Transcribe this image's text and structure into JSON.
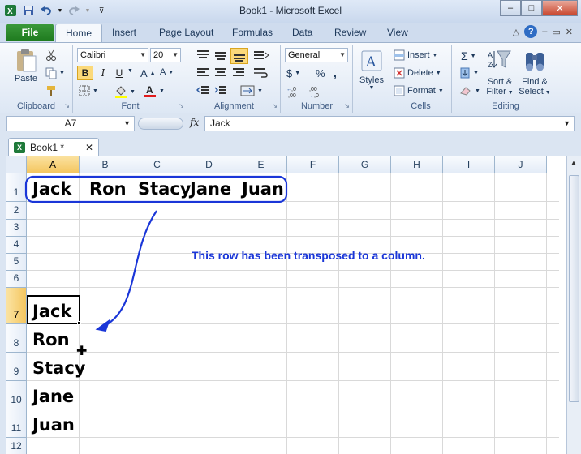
{
  "window": {
    "title": "Book1 - Microsoft Excel",
    "controls": {
      "minimize": "–",
      "maximize": "□",
      "close": "✕"
    }
  },
  "ribbon_tabs": {
    "file": "File",
    "tabs": [
      "Home",
      "Insert",
      "Page Layout",
      "Formulas",
      "Data",
      "Review",
      "View"
    ],
    "active": "Home"
  },
  "ribbon": {
    "clipboard": {
      "label": "Clipboard",
      "paste": "Paste"
    },
    "font": {
      "label": "Font",
      "name": "Calibri",
      "size": "20",
      "bold": "B",
      "italic": "I",
      "underline": "U"
    },
    "alignment": {
      "label": "Alignment"
    },
    "number": {
      "label": "Number",
      "format": "General",
      "currency": "$",
      "percent": "%",
      "comma": ","
    },
    "styles": {
      "label": "Styles"
    },
    "cells": {
      "label": "Cells",
      "insert": "Insert",
      "delete": "Delete",
      "format": "Format"
    },
    "editing": {
      "label": "Editing",
      "sort_line1": "Sort &",
      "sort_line2": "Filter",
      "find_line1": "Find &",
      "find_line2": "Select"
    }
  },
  "formula_bar": {
    "name_box": "A7",
    "fx": "fx",
    "value": "Jack"
  },
  "workbook_tab": {
    "title": "Book1 *",
    "close": "✕",
    "icon": "X"
  },
  "sheet": {
    "columns": [
      "A",
      "B",
      "C",
      "D",
      "E",
      "F",
      "G",
      "H",
      "I",
      "J"
    ],
    "rows": [
      "1",
      "2",
      "3",
      "4",
      "5",
      "6",
      "7",
      "8",
      "9",
      "10",
      "11",
      "12"
    ],
    "row1_values": [
      "Jack",
      "Ron",
      "Stacy",
      "Jane",
      "Juan"
    ],
    "colA_values": [
      "Jack",
      "Ron",
      "Stacy",
      "Jane",
      "Juan"
    ],
    "annotation": "This row has been transposed to a column.",
    "active_cell": "A7",
    "highlight_color": "#1a36d8"
  }
}
